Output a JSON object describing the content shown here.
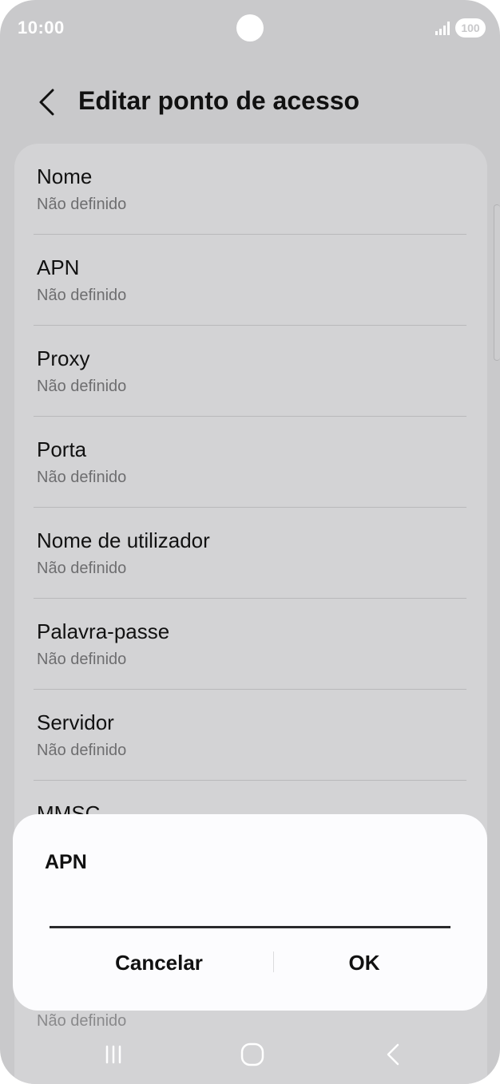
{
  "status_bar": {
    "time": "10:00",
    "battery": "100",
    "icons": [
      "camera-cutout",
      "signal-icon",
      "battery-icon"
    ]
  },
  "header": {
    "title": "Editar ponto de acesso",
    "back_icon": "chevron-left-icon"
  },
  "settings": {
    "items": [
      {
        "title": "Nome",
        "value": "Não definido"
      },
      {
        "title": "APN",
        "value": "Não definido"
      },
      {
        "title": "Proxy",
        "value": "Não definido"
      },
      {
        "title": "Porta",
        "value": "Não definido"
      },
      {
        "title": "Nome de utilizador",
        "value": "Não definido"
      },
      {
        "title": "Palavra-passe",
        "value": "Não definido"
      },
      {
        "title": "Servidor",
        "value": "Não definido"
      },
      {
        "title": "MMSC",
        "value": ""
      }
    ],
    "peek_value": "Não definido"
  },
  "dialog": {
    "title": "APN",
    "input_value": "",
    "cancel_label": "Cancelar",
    "ok_label": "OK"
  },
  "nav_bar": {
    "icons": [
      "recent-apps-icon",
      "home-icon",
      "back-icon"
    ]
  },
  "colors": {
    "dim_background": "#c9c9cb",
    "card_background": "#d3d3d5",
    "dialog_background": "#fcfcfe",
    "text_primary": "#111111",
    "text_secondary": "#6e6e70"
  }
}
